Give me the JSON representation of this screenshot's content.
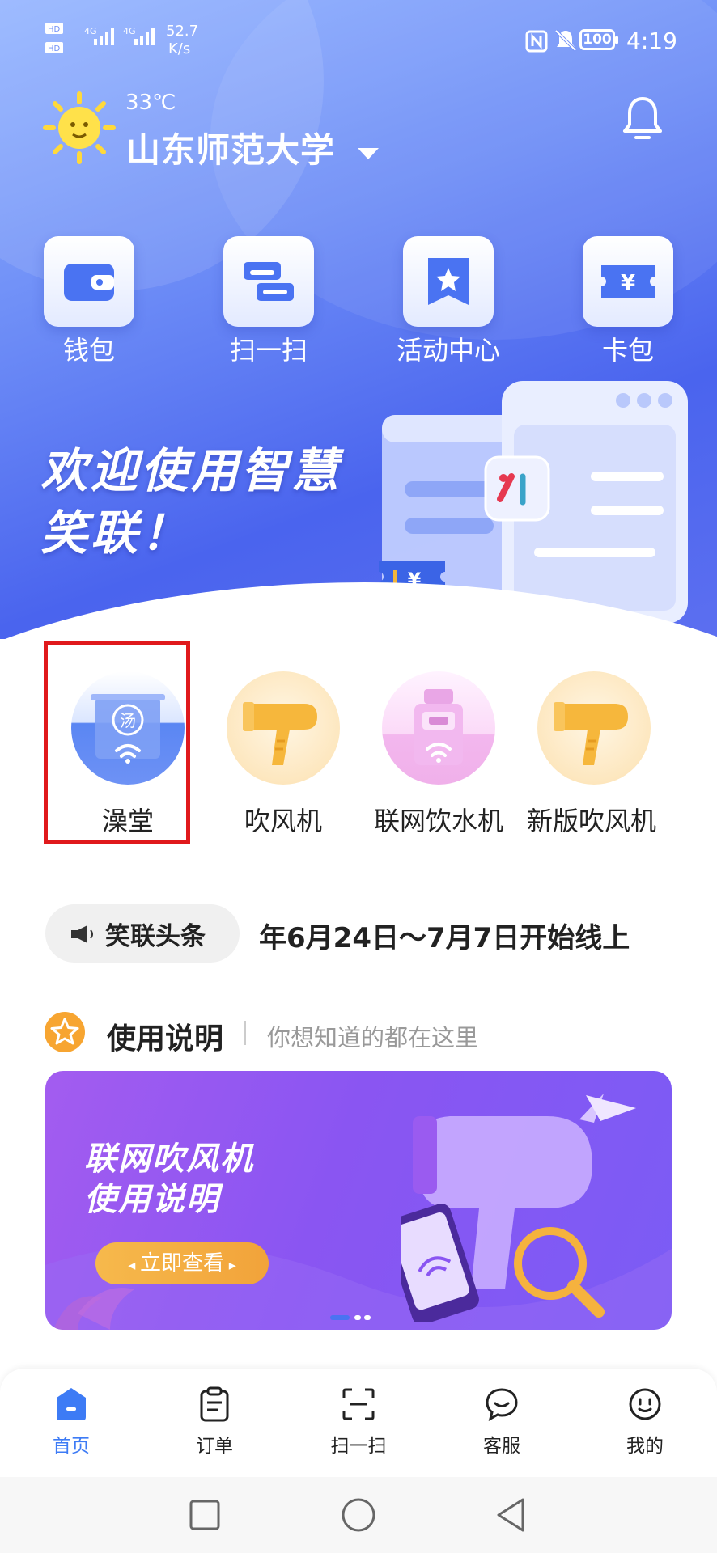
{
  "status_bar": {
    "network_speed_value": "52.7",
    "network_speed_unit": "K/s",
    "battery": "100",
    "time": "4:19"
  },
  "header": {
    "temperature": "33℃",
    "location": "山东师范大学"
  },
  "quick_actions": [
    {
      "label": "钱包",
      "icon": "wallet-icon"
    },
    {
      "label": "扫一扫",
      "icon": "scan-icon"
    },
    {
      "label": "活动中心",
      "icon": "star-bookmark-icon"
    },
    {
      "label": "卡包",
      "icon": "yuan-ticket-icon"
    }
  ],
  "hero_banner": {
    "line1": "欢迎使用智慧",
    "line2": "笑联！"
  },
  "services": [
    {
      "label": "澡堂",
      "icon": "bathhouse-icon",
      "selected": true
    },
    {
      "label": "吹风机",
      "icon": "hair-dryer-icon"
    },
    {
      "label": "联网饮水机",
      "icon": "water-dispenser-icon"
    },
    {
      "label": "新版吹风机",
      "icon": "hair-dryer-icon"
    }
  ],
  "news": {
    "tag": "笑联头条",
    "ticker": "年6月24日～7月7日开始线上"
  },
  "instructions": {
    "title": "使用说明",
    "subtitle": "你想知道的都在这里",
    "banner_line1": "联网吹风机",
    "banner_line2": "使用说明",
    "banner_button": "立即查看"
  },
  "tab_bar": [
    {
      "label": "首页",
      "icon": "home-icon",
      "active": true
    },
    {
      "label": "订单",
      "icon": "clipboard-icon"
    },
    {
      "label": "扫一扫",
      "icon": "scan-frame-icon"
    },
    {
      "label": "客服",
      "icon": "chat-bubble-icon"
    },
    {
      "label": "我的",
      "icon": "smiley-icon"
    }
  ],
  "colors": {
    "accent": "#3d7bf5",
    "highlight_box": "#e0191c",
    "hero_blue": "#4a64ee",
    "banner_purple": "#8a55f2",
    "button_orange": "#f2a33a"
  }
}
